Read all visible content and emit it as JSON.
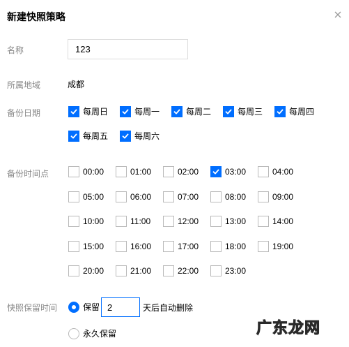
{
  "dialog": {
    "title": "新建快照策略"
  },
  "name": {
    "label": "名称",
    "value": "123"
  },
  "region": {
    "label": "所属地域",
    "value": "成都"
  },
  "backup_date": {
    "label": "备份日期",
    "options": [
      {
        "label": "每周日",
        "checked": true
      },
      {
        "label": "每周一",
        "checked": true
      },
      {
        "label": "每周二",
        "checked": true
      },
      {
        "label": "每周三",
        "checked": true
      },
      {
        "label": "每周四",
        "checked": true
      },
      {
        "label": "每周五",
        "checked": true
      },
      {
        "label": "每周六",
        "checked": true
      }
    ]
  },
  "backup_time": {
    "label": "备份时间点",
    "options": [
      {
        "label": "00:00",
        "checked": false
      },
      {
        "label": "01:00",
        "checked": false
      },
      {
        "label": "02:00",
        "checked": false
      },
      {
        "label": "03:00",
        "checked": true
      },
      {
        "label": "04:00",
        "checked": false
      },
      {
        "label": "05:00",
        "checked": false
      },
      {
        "label": "06:00",
        "checked": false
      },
      {
        "label": "07:00",
        "checked": false
      },
      {
        "label": "08:00",
        "checked": false
      },
      {
        "label": "09:00",
        "checked": false
      },
      {
        "label": "10:00",
        "checked": false
      },
      {
        "label": "11:00",
        "checked": false
      },
      {
        "label": "12:00",
        "checked": false
      },
      {
        "label": "13:00",
        "checked": false
      },
      {
        "label": "14:00",
        "checked": false
      },
      {
        "label": "15:00",
        "checked": false
      },
      {
        "label": "16:00",
        "checked": false
      },
      {
        "label": "17:00",
        "checked": false
      },
      {
        "label": "18:00",
        "checked": false
      },
      {
        "label": "19:00",
        "checked": false
      },
      {
        "label": "20:00",
        "checked": false
      },
      {
        "label": "21:00",
        "checked": false
      },
      {
        "label": "22:00",
        "checked": false
      },
      {
        "label": "23:00",
        "checked": false
      }
    ]
  },
  "retention": {
    "label": "快照保留时间",
    "keep_label": "保留",
    "keep_selected": true,
    "days_value": "2",
    "days_suffix": "天后自动删除",
    "forever_label": "永久保留",
    "forever_selected": false
  },
  "watermark": "广东龙网",
  "colors": {
    "accent": "#006eff",
    "label_gray": "#888888",
    "border": "#dcdcdc"
  }
}
